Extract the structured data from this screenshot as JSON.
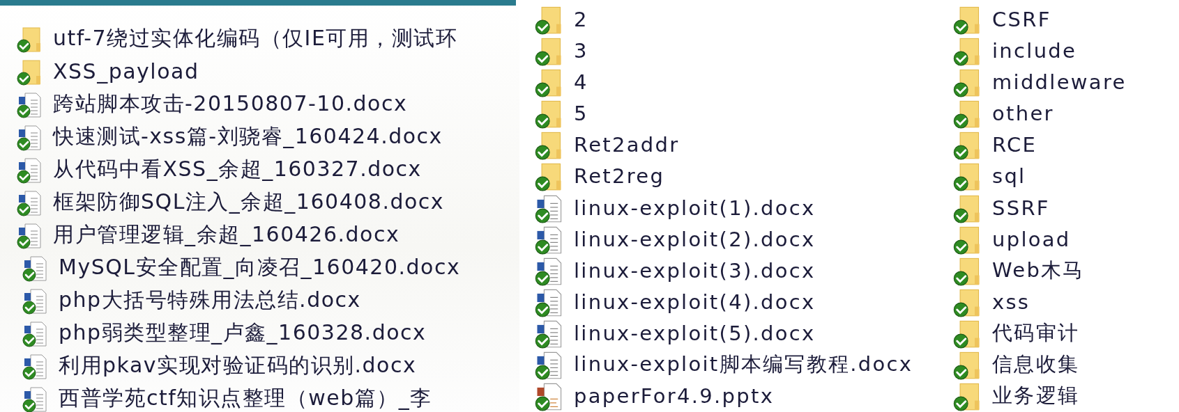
{
  "left_panel": {
    "items": [
      {
        "name": "utf-7绕过实体化编码（仅IE可用，测试环",
        "kind": "folder"
      },
      {
        "name": "XSS_payload",
        "kind": "folder"
      },
      {
        "name": "跨站脚本攻击-20150807-10.docx",
        "kind": "docx"
      },
      {
        "name": "快速测试-xss篇-刘骁睿_160424.docx",
        "kind": "docx"
      },
      {
        "name": "从代码中看XSS_余超_160327.docx",
        "kind": "docx"
      },
      {
        "name": "框架防御SQL注入_余超_160408.docx",
        "kind": "docx"
      },
      {
        "name": "用户管理逻辑_余超_160426.docx",
        "kind": "docx"
      },
      {
        "name": "MySQL安全配置_向凌召_160420.docx",
        "kind": "docx"
      },
      {
        "name": "php大括号特殊用法总结.docx",
        "kind": "docx"
      },
      {
        "name": "php弱类型整理_卢鑫_160328.docx",
        "kind": "docx"
      },
      {
        "name": "利用pkav实现对验证码的识别.docx",
        "kind": "docx"
      },
      {
        "name": "西普学苑ctf知识点整理（web篇）_李",
        "kind": "docx"
      }
    ]
  },
  "file_list": {
    "columns": [
      {
        "items": [
          {
            "name": "2",
            "kind": "folder"
          },
          {
            "name": "3",
            "kind": "folder"
          },
          {
            "name": "4",
            "kind": "folder"
          },
          {
            "name": "5",
            "kind": "folder"
          },
          {
            "name": "Ret2addr",
            "kind": "folder"
          },
          {
            "name": "Ret2reg",
            "kind": "folder"
          },
          {
            "name": "linux-exploit(1).docx",
            "kind": "docx"
          },
          {
            "name": "linux-exploit(2).docx",
            "kind": "docx"
          },
          {
            "name": "linux-exploit(3).docx",
            "kind": "docx"
          },
          {
            "name": "linux-exploit(4).docx",
            "kind": "docx"
          },
          {
            "name": "linux-exploit(5).docx",
            "kind": "docx"
          },
          {
            "name": "linux-exploit脚本编写教程.docx",
            "kind": "docx"
          },
          {
            "name": "paperFor4.9.pptx",
            "kind": "pptx"
          }
        ]
      },
      {
        "items": [
          {
            "name": "CSRF",
            "kind": "folder"
          },
          {
            "name": "include",
            "kind": "folder"
          },
          {
            "name": "middleware",
            "kind": "folder"
          },
          {
            "name": "other",
            "kind": "folder"
          },
          {
            "name": "RCE",
            "kind": "folder"
          },
          {
            "name": "sql",
            "kind": "folder"
          },
          {
            "name": "SSRF",
            "kind": "folder"
          },
          {
            "name": "upload",
            "kind": "folder"
          },
          {
            "name": "Web木马",
            "kind": "folder"
          },
          {
            "name": "xss",
            "kind": "folder"
          },
          {
            "name": "代码审计",
            "kind": "folder"
          },
          {
            "name": "信息收集",
            "kind": "folder"
          },
          {
            "name": "业务逻辑",
            "kind": "folder"
          }
        ]
      }
    ]
  }
}
